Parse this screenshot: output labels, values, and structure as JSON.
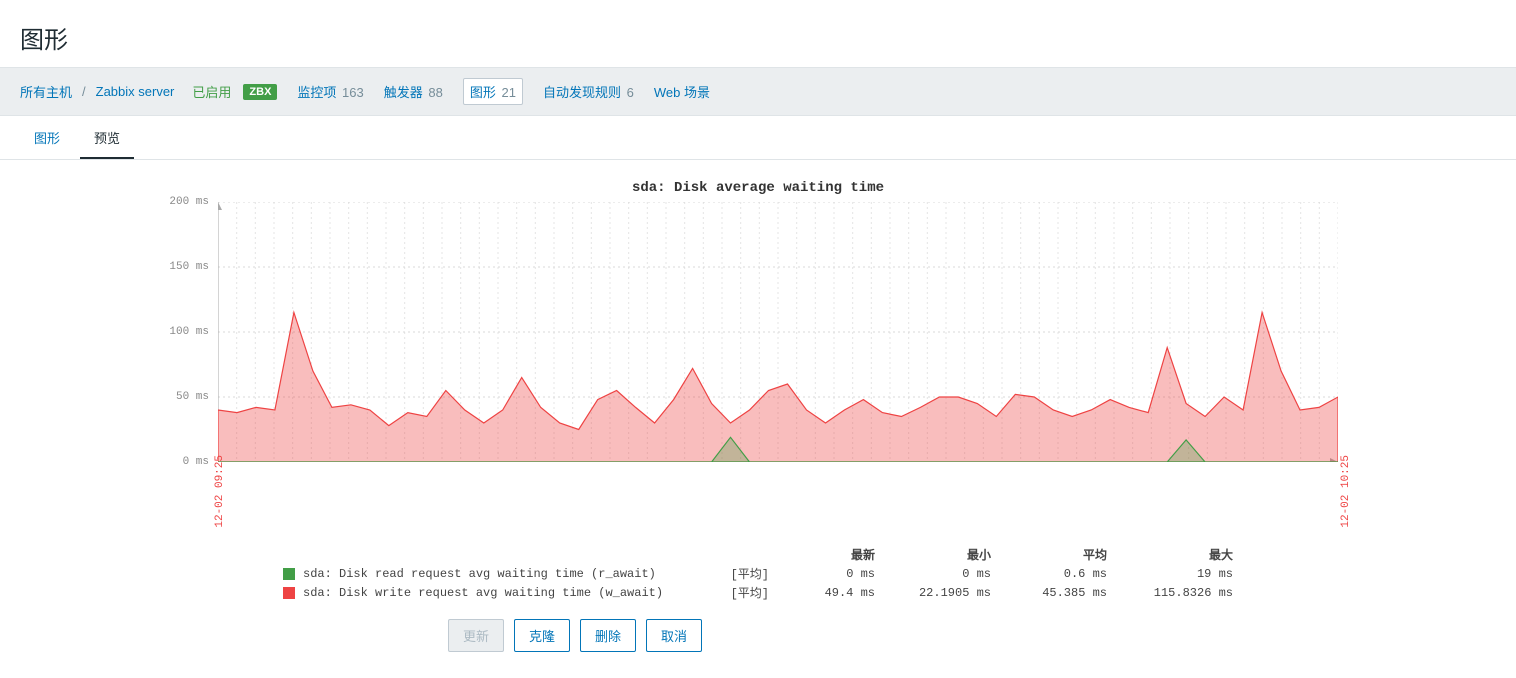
{
  "page": {
    "title": "图形"
  },
  "breadcrumb": {
    "all_hosts": "所有主机",
    "host": "Zabbix server",
    "enabled": "已启用",
    "zbx_badge": "ZBX"
  },
  "nav": {
    "items": {
      "label": "监控项",
      "count": 163
    },
    "triggers": {
      "label": "触发器",
      "count": 88
    },
    "graphs": {
      "label": "图形",
      "count": 21
    },
    "discovery": {
      "label": "自动发现规则",
      "count": 6
    },
    "web": {
      "label": "Web 场景"
    }
  },
  "tabs": {
    "graph": "图形",
    "preview": "预览"
  },
  "chart_data": {
    "type": "area",
    "title": "sda: Disk average waiting time",
    "ylabel": "ms",
    "ylim": [
      0,
      200
    ],
    "yticks_text": [
      "0 ms",
      "50 ms",
      "100 ms",
      "150 ms",
      "200 ms"
    ],
    "x_range_labels": [
      "12-02 09:25",
      "12-02 10:25"
    ],
    "series": [
      {
        "name": "sda: Disk read request avg waiting time (r_await)",
        "color": "#429e47",
        "aggregate": "[平均]",
        "stats": {
          "latest": "0 ms",
          "min": "0 ms",
          "avg": "0.6 ms",
          "max": "19 ms"
        },
        "values": [
          0,
          0,
          0,
          0,
          0,
          0,
          0,
          0,
          0,
          0,
          0,
          0,
          0,
          0,
          0,
          0,
          0,
          0,
          0,
          0,
          0,
          0,
          0,
          0,
          0,
          0,
          0,
          19,
          0,
          0,
          0,
          0,
          0,
          0,
          0,
          0,
          0,
          0,
          0,
          0,
          0,
          0,
          0,
          0,
          0,
          0,
          0,
          0,
          0,
          0,
          0,
          17,
          0,
          0,
          0,
          0,
          0,
          0,
          0,
          0
        ]
      },
      {
        "name": "sda: Disk write request avg waiting time (w_await)",
        "color": "#ee4343",
        "aggregate": "[平均]",
        "stats": {
          "latest": "49.4 ms",
          "min": "22.1905 ms",
          "avg": "45.385 ms",
          "max": "115.8326 ms"
        },
        "values": [
          40,
          38,
          42,
          40,
          115,
          70,
          42,
          44,
          40,
          28,
          38,
          35,
          55,
          40,
          30,
          40,
          65,
          42,
          30,
          25,
          48,
          55,
          42,
          30,
          48,
          72,
          45,
          30,
          40,
          55,
          60,
          40,
          30,
          40,
          48,
          38,
          35,
          42,
          50,
          50,
          45,
          35,
          52,
          50,
          40,
          35,
          40,
          48,
          42,
          38,
          88,
          45,
          35,
          50,
          40,
          115,
          70,
          40,
          42,
          50
        ]
      }
    ],
    "legend_headers": {
      "latest": "最新",
      "min": "最小",
      "avg": "平均",
      "max": "最大"
    }
  },
  "buttons": {
    "update": "更新",
    "clone": "克隆",
    "delete": "删除",
    "cancel": "取消"
  }
}
